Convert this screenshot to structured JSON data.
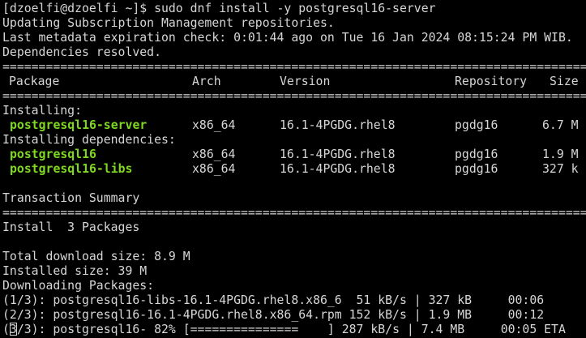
{
  "prompt": "[dzoelfi@dzoelfi ~]$ ",
  "command": "sudo dnf install -y postgresql16-server",
  "messages": [
    "Updating Subscription Management repositories.",
    "Last metadata expiration check: 0:01:44 ago on Tue 16 Jan 2024 08:15:24 PM WIB.",
    "Dependencies resolved."
  ],
  "rule_char": "=",
  "table": {
    "headers": {
      "package": "Package",
      "arch": "Arch",
      "version": "Version",
      "repository": "Repository",
      "size": "Size"
    },
    "installing_label": "Installing:",
    "installing": [
      {
        "package": "postgresql16-server",
        "arch": "x86_64",
        "version": "16.1-4PGDG.rhel8",
        "repository": "pgdg16",
        "size": "6.7 M"
      }
    ],
    "dependencies_label": "Installing dependencies:",
    "dependencies": [
      {
        "package": "postgresql16",
        "arch": "x86_64",
        "version": "16.1-4PGDG.rhel8",
        "repository": "pgdg16",
        "size": "1.9 M"
      },
      {
        "package": "postgresql16-libs",
        "arch": "x86_64",
        "version": "16.1-4PGDG.rhel8",
        "repository": "pgdg16",
        "size": "327 k"
      }
    ]
  },
  "summary": {
    "title": "Transaction Summary",
    "install_line": "Install  3 Packages",
    "download_size": "Total download size: 8.9 M",
    "installed_size": "Installed size: 39 M",
    "downloading": "Downloading Packages:"
  },
  "progress": [
    {
      "text": "(1/3): postgresql16-libs-16.1-4PGDG.rhel8.x86_6  51 kB/s | 327 kB     00:06"
    },
    {
      "text": "(2/3): postgresql16-16.1-4PGDG.rhel8.x86_64.rpm 152 kB/s | 1.9 MB     00:12"
    },
    {
      "text_a": "(",
      "text_b": "3/3): postgresql16- 82% [===============    ] 287 kB/s | 7.4 MB     00:05 ETA"
    }
  ]
}
